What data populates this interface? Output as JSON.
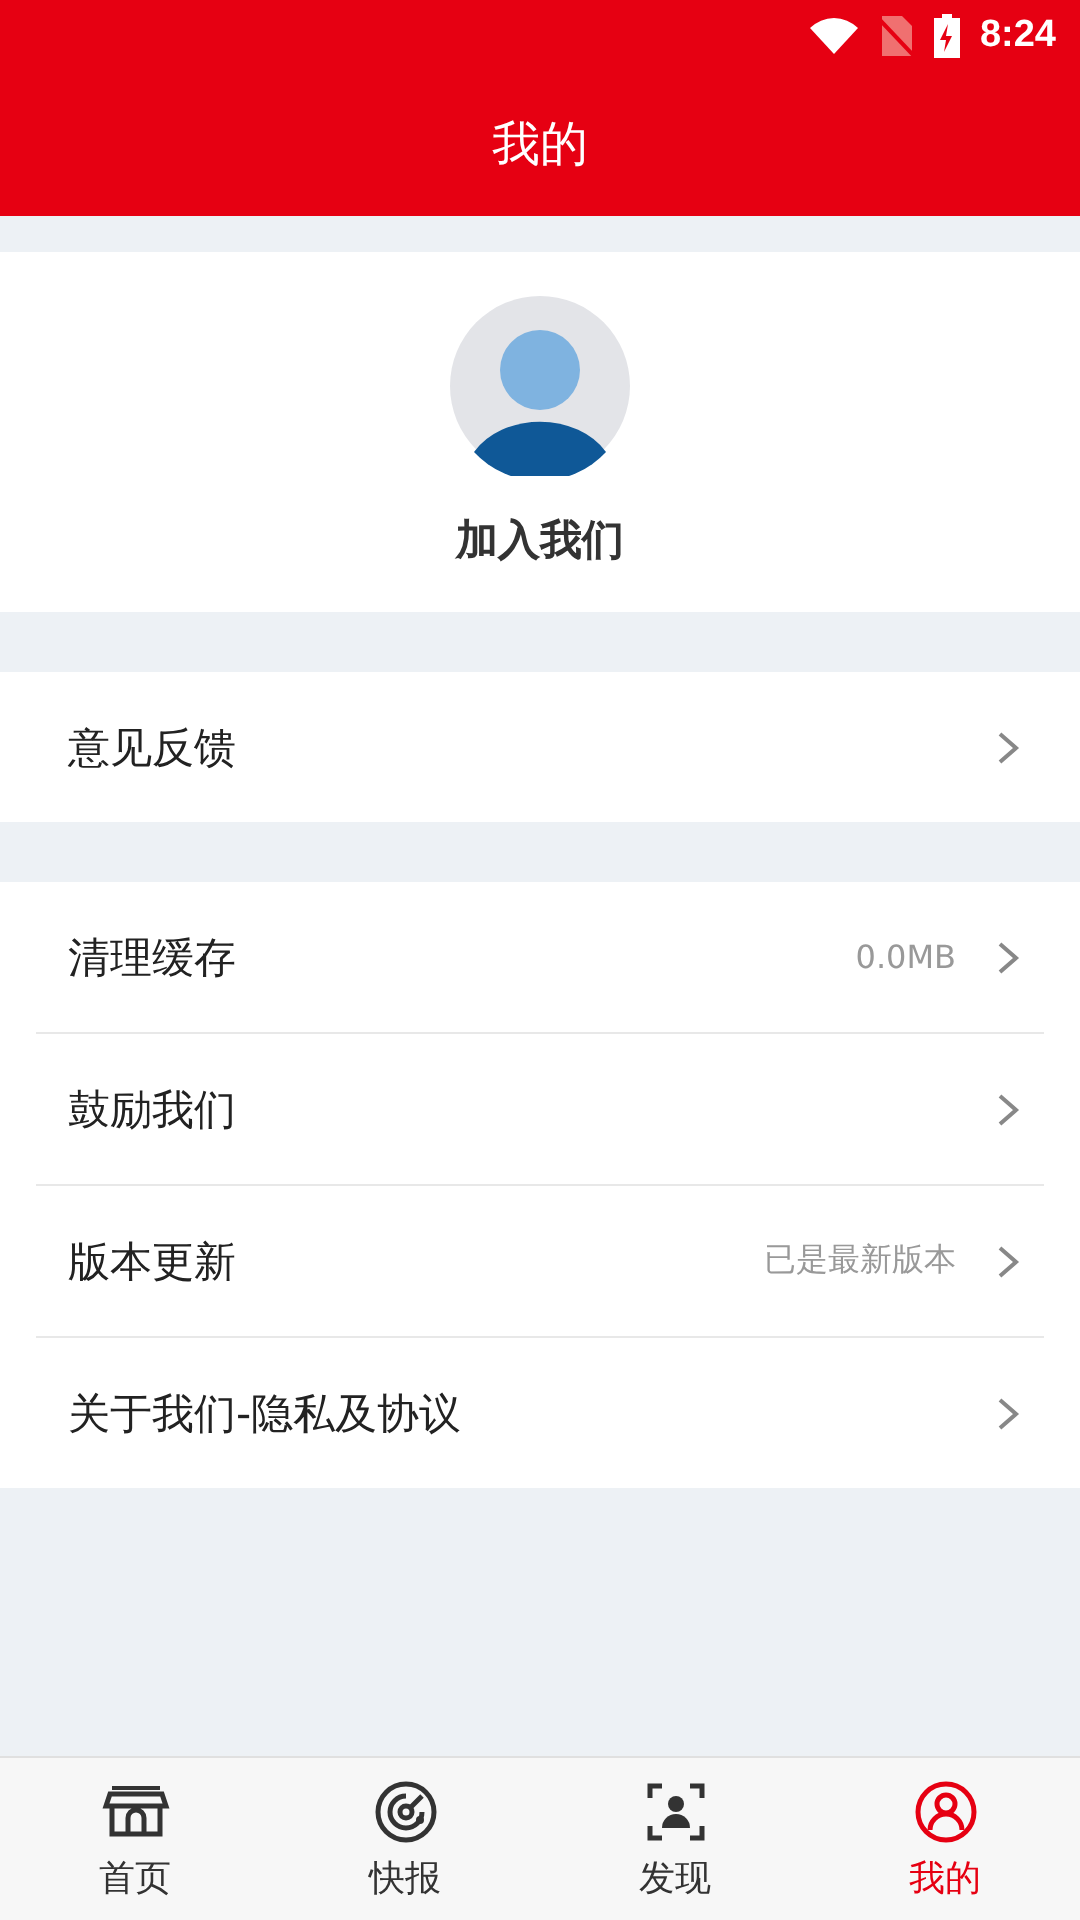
{
  "status_bar": {
    "time": "8:24"
  },
  "header": {
    "title": "我的"
  },
  "profile": {
    "label": "加入我们"
  },
  "groups": [
    [
      {
        "label": "意见反馈"
      }
    ],
    [
      {
        "label": "清理缓存",
        "value": "0.0MB"
      },
      {
        "label": "鼓励我们"
      },
      {
        "label": "版本更新",
        "value": "已是最新版本"
      },
      {
        "label": "关于我们-隐私及协议"
      }
    ]
  ],
  "tabs": [
    {
      "label": "首页",
      "kind": "store",
      "selected": false
    },
    {
      "label": "快报",
      "kind": "radar",
      "selected": false
    },
    {
      "label": "发现",
      "kind": "scan",
      "selected": false
    },
    {
      "label": "我的",
      "kind": "person",
      "selected": true
    }
  ]
}
